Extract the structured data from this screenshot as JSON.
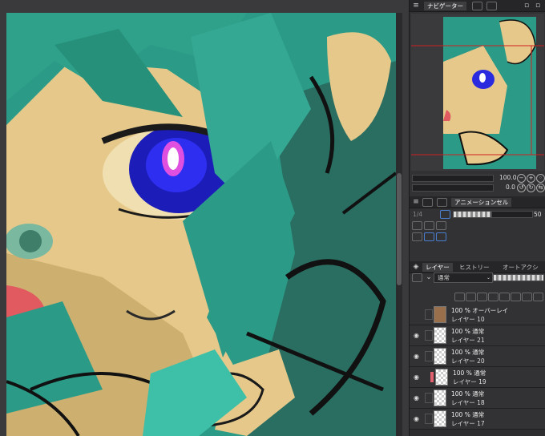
{
  "navigator": {
    "tab_label": "ナビゲーター",
    "zoom_value": "100.0",
    "rotate_value": "0.0"
  },
  "animation": {
    "tab_label": "アニメーションセル",
    "frame_value": "50",
    "frame_left": "1/4"
  },
  "layers_panel": {
    "tab_layer": "レイヤー",
    "tab_history": "ヒストリー",
    "tab_auto_action": "オートアクシ",
    "blend_mode": "通常",
    "layers": [
      {
        "opacity_mode": "100 % オーバーレイ",
        "name": "レイヤー 10",
        "visible": false,
        "selected": false,
        "thumb": "brown"
      },
      {
        "opacity_mode": "100 % 通常",
        "name": "レイヤー 21",
        "visible": true,
        "selected": false,
        "thumb": "check"
      },
      {
        "opacity_mode": "100 % 通常",
        "name": "レイヤー 20",
        "visible": true,
        "selected": false,
        "thumb": "check"
      },
      {
        "opacity_mode": "100 % 通常",
        "name": "レイヤー 19",
        "visible": true,
        "selected": false,
        "thumb": "check",
        "marker": "#e06070"
      },
      {
        "opacity_mode": "100 % 通常",
        "name": "レイヤー 18",
        "visible": true,
        "selected": false,
        "thumb": "check"
      },
      {
        "opacity_mode": "100 % 通常",
        "name": "レイヤー 17",
        "visible": true,
        "selected": false,
        "thumb": "check"
      }
    ]
  },
  "colors": {
    "panel_bg": "#323234",
    "accent_blue": "#4a7fd0",
    "nav_frame": "#d02020",
    "hair": "#2fa08a",
    "skin": "#e6c98a",
    "eye": "#2a2adf"
  }
}
